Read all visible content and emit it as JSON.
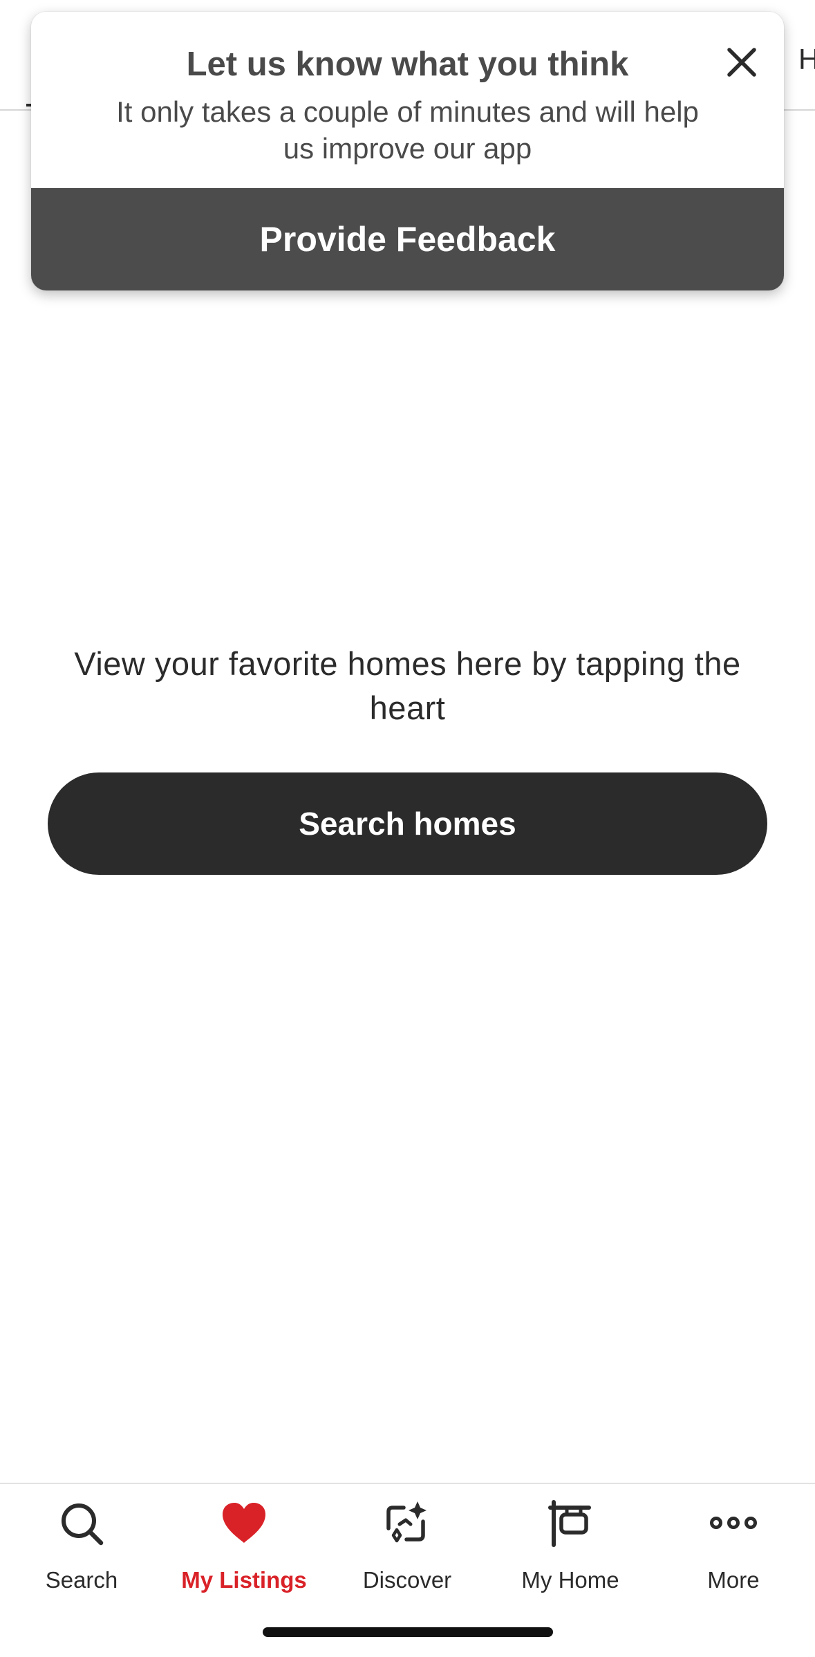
{
  "top_tabs": {
    "right_peek_label": "H"
  },
  "feedback": {
    "title": "Let us know what you think",
    "subtitle": "It only takes a couple of minutes and will help us improve our app",
    "button_label": "Provide Feedback",
    "close_icon": "close-icon"
  },
  "empty_state": {
    "message": "View your favorite homes here by tapping the heart",
    "button_label": "Search homes"
  },
  "bottom_nav": {
    "accent_color": "#d92228",
    "items": [
      {
        "label": "Search",
        "icon": "search-icon"
      },
      {
        "label": "My Listings",
        "icon": "heart-icon",
        "active": true
      },
      {
        "label": "Discover",
        "icon": "discover-icon"
      },
      {
        "label": "My Home",
        "icon": "my-home-icon"
      },
      {
        "label": "More",
        "icon": "more-icon"
      }
    ]
  }
}
